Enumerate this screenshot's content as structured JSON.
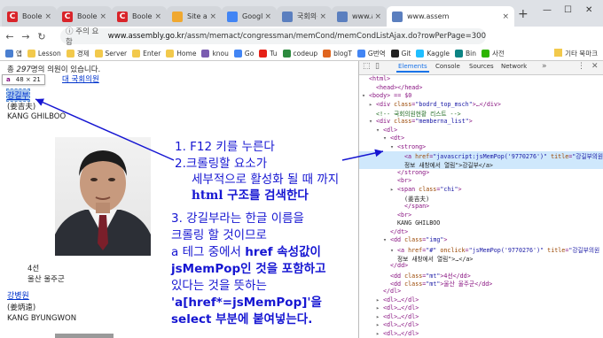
{
  "tabs": [
    {
      "label": "Boolean ㄹ",
      "icon": "C"
    },
    {
      "label": "Boolean ㄹ",
      "icon": "C"
    },
    {
      "label": "Boolean ㄹ",
      "icon": "C"
    },
    {
      "label": "Site admin",
      "icon": "site-admin-icon"
    },
    {
      "label": "Google 번",
      "icon": "google-translate-icon"
    },
    {
      "label": "국회의원현",
      "icon": "assembly-icon"
    },
    {
      "label": "www.assem",
      "icon": "assembly-icon"
    },
    {
      "label": "www.assem",
      "icon": "assembly-icon"
    }
  ],
  "address": {
    "security": "ⓘ 주의 요함",
    "url_host": "www.assembly.go.kr",
    "url_path": "/assm/memact/congressman/memCond/memCondListAjax.do?rowPerPage=300"
  },
  "bookmarks": {
    "items": [
      "앱",
      "Lesson",
      "경제",
      "Server",
      "Enter",
      "Home",
      "knou",
      "Go",
      "Tu",
      "codeup",
      "blogT",
      "G번역",
      "Git",
      "Kaggle",
      "Bin",
      "사전"
    ],
    "right": "기타 북마크"
  },
  "page": {
    "total_prefix": "총 ",
    "total_count": "297",
    "total_suffix": "명의 의원이 있습니다.",
    "subtitle": "대 국회의원",
    "tooltip_tag": "a",
    "tooltip_size": "48 × 21",
    "member1": {
      "name": "강길부",
      "hanja": "(姜吉夫)",
      "eng": "KANG GHILBOO",
      "term": "4선",
      "district": "울산 울주군"
    },
    "member2": {
      "name": "강병원",
      "hanja": "(姜炳遠)",
      "eng": "KANG BYUNGWON"
    }
  },
  "devtools": {
    "tabs": [
      "Elements",
      "Console",
      "Sources",
      "Network"
    ],
    "lines": [
      {
        "ind": 0,
        "tri": "",
        "t": "<html>"
      },
      {
        "ind": 1,
        "tri": "",
        "t": "<head></head>"
      },
      {
        "ind": 0,
        "tri": "▾",
        "t": "<body> == $0"
      },
      {
        "ind": 1,
        "tri": "▸",
        "t": "<div class=\"bodrd_top_msch\">…</div>"
      },
      {
        "ind": 1,
        "tri": "",
        "t": "<!-- 국회의원현황 리스트 -->"
      },
      {
        "ind": 1,
        "tri": "▾",
        "t": "<div class=\"memberna_list\">"
      },
      {
        "ind": 2,
        "tri": "▾",
        "t": "<dl>"
      },
      {
        "ind": 3,
        "tri": "▾",
        "t": "<dt>"
      },
      {
        "ind": 4,
        "tri": "▾",
        "t": "<strong>"
      },
      {
        "ind": 5,
        "tri": "",
        "t": "<a href=\"javascript:jsMemPop('9770276')\" title=\"강길부의원"
      },
      {
        "ind": 5,
        "tri": "",
        "t": "정보 새창에서 열림\">강길부</a>"
      },
      {
        "ind": 4,
        "tri": "",
        "t": "</strong>"
      },
      {
        "ind": 4,
        "tri": "",
        "t": "<br>"
      },
      {
        "ind": 4,
        "tri": "▸",
        "t": "<span class=\"chi\">"
      },
      {
        "ind": 5,
        "tri": "",
        "t": "(姜吉夫)"
      },
      {
        "ind": 5,
        "tri": "",
        "t": "</span>"
      },
      {
        "ind": 4,
        "tri": "",
        "t": "<br>"
      },
      {
        "ind": 4,
        "tri": "",
        "t": "KANG GHILBOO"
      },
      {
        "ind": 3,
        "tri": "",
        "t": "</dt>"
      },
      {
        "ind": 3,
        "tri": "▾",
        "t": "<dd class=\"img\">"
      },
      {
        "ind": 4,
        "tri": "▾",
        "t": "<a href=\"#\" onclick=\"jsMemPop('9770276')\" title=\"강길부의원"
      },
      {
        "ind": 4,
        "tri": "",
        "t": "정보 새창에서 열림\">…</a>"
      },
      {
        "ind": 3,
        "tri": "",
        "t": "</dd>"
      },
      {
        "ind": 3,
        "tri": "",
        "t": "<dd class=\"mt\">4선</dd>"
      },
      {
        "ind": 3,
        "tri": "",
        "t": "<dd class=\"mt\">울산 울주군</dd>"
      },
      {
        "ind": 2,
        "tri": "",
        "t": "</dl>"
      },
      {
        "ind": 2,
        "tri": "▸",
        "t": "<dl>…</dl>"
      },
      {
        "ind": 2,
        "tri": "▸",
        "t": "<dl>…</dl>"
      },
      {
        "ind": 2,
        "tri": "▸",
        "t": "<dl>…</dl>"
      },
      {
        "ind": 2,
        "tri": "▸",
        "t": "<dl>…</dl>"
      },
      {
        "ind": 2,
        "tri": "▸",
        "t": "<dl>…</dl>"
      }
    ]
  },
  "annotation": {
    "l1": "1. F12 키를 누른다",
    "l2": "2.크롤링할 요소가",
    "l3": "세부적으로 활성화 될 때 까지",
    "l4": "html 구조를 검색한다",
    "l5": "3. 강길부라는 한글 이름을",
    "l6": "크롤링 할 것이므로",
    "l7a": "a 테그 중에서 ",
    "l7b": "href 속성값이",
    "l8": "jsMemPop인 것을 포함하고",
    "l9": "있다는 것을 뜻하는",
    "l10": "'a[href*=jsMemPop]'을",
    "l11": "select 부분에 붙여넣는다."
  },
  "colors": {
    "annotation": "#1616d2",
    "tabstrip": "#dee1e6",
    "selection": "#cfe8fc"
  }
}
